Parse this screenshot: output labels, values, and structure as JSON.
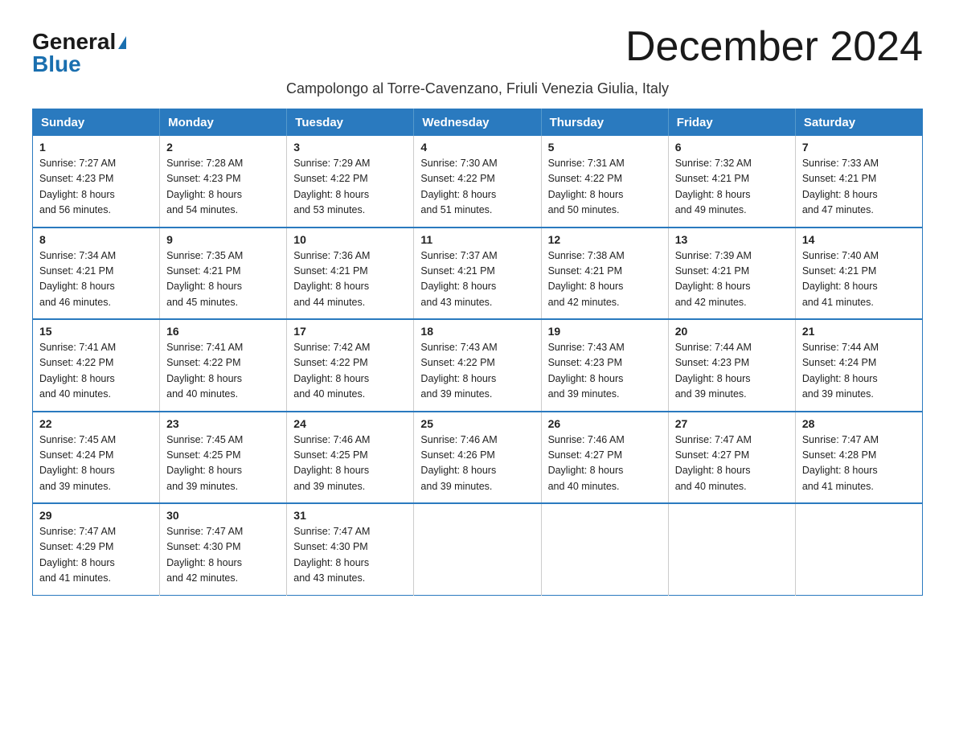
{
  "logo": {
    "general": "General",
    "blue": "Blue",
    "triangle": "▶"
  },
  "title": "December 2024",
  "subtitle": "Campolongo al Torre-Cavenzano, Friuli Venezia Giulia, Italy",
  "days_of_week": [
    "Sunday",
    "Monday",
    "Tuesday",
    "Wednesday",
    "Thursday",
    "Friday",
    "Saturday"
  ],
  "weeks": [
    [
      {
        "day": "1",
        "sunrise": "7:27 AM",
        "sunset": "4:23 PM",
        "daylight": "8 hours and 56 minutes."
      },
      {
        "day": "2",
        "sunrise": "7:28 AM",
        "sunset": "4:23 PM",
        "daylight": "8 hours and 54 minutes."
      },
      {
        "day": "3",
        "sunrise": "7:29 AM",
        "sunset": "4:22 PM",
        "daylight": "8 hours and 53 minutes."
      },
      {
        "day": "4",
        "sunrise": "7:30 AM",
        "sunset": "4:22 PM",
        "daylight": "8 hours and 51 minutes."
      },
      {
        "day": "5",
        "sunrise": "7:31 AM",
        "sunset": "4:22 PM",
        "daylight": "8 hours and 50 minutes."
      },
      {
        "day": "6",
        "sunrise": "7:32 AM",
        "sunset": "4:21 PM",
        "daylight": "8 hours and 49 minutes."
      },
      {
        "day": "7",
        "sunrise": "7:33 AM",
        "sunset": "4:21 PM",
        "daylight": "8 hours and 47 minutes."
      }
    ],
    [
      {
        "day": "8",
        "sunrise": "7:34 AM",
        "sunset": "4:21 PM",
        "daylight": "8 hours and 46 minutes."
      },
      {
        "day": "9",
        "sunrise": "7:35 AM",
        "sunset": "4:21 PM",
        "daylight": "8 hours and 45 minutes."
      },
      {
        "day": "10",
        "sunrise": "7:36 AM",
        "sunset": "4:21 PM",
        "daylight": "8 hours and 44 minutes."
      },
      {
        "day": "11",
        "sunrise": "7:37 AM",
        "sunset": "4:21 PM",
        "daylight": "8 hours and 43 minutes."
      },
      {
        "day": "12",
        "sunrise": "7:38 AM",
        "sunset": "4:21 PM",
        "daylight": "8 hours and 42 minutes."
      },
      {
        "day": "13",
        "sunrise": "7:39 AM",
        "sunset": "4:21 PM",
        "daylight": "8 hours and 42 minutes."
      },
      {
        "day": "14",
        "sunrise": "7:40 AM",
        "sunset": "4:21 PM",
        "daylight": "8 hours and 41 minutes."
      }
    ],
    [
      {
        "day": "15",
        "sunrise": "7:41 AM",
        "sunset": "4:22 PM",
        "daylight": "8 hours and 40 minutes."
      },
      {
        "day": "16",
        "sunrise": "7:41 AM",
        "sunset": "4:22 PM",
        "daylight": "8 hours and 40 minutes."
      },
      {
        "day": "17",
        "sunrise": "7:42 AM",
        "sunset": "4:22 PM",
        "daylight": "8 hours and 40 minutes."
      },
      {
        "day": "18",
        "sunrise": "7:43 AM",
        "sunset": "4:22 PM",
        "daylight": "8 hours and 39 minutes."
      },
      {
        "day": "19",
        "sunrise": "7:43 AM",
        "sunset": "4:23 PM",
        "daylight": "8 hours and 39 minutes."
      },
      {
        "day": "20",
        "sunrise": "7:44 AM",
        "sunset": "4:23 PM",
        "daylight": "8 hours and 39 minutes."
      },
      {
        "day": "21",
        "sunrise": "7:44 AM",
        "sunset": "4:24 PM",
        "daylight": "8 hours and 39 minutes."
      }
    ],
    [
      {
        "day": "22",
        "sunrise": "7:45 AM",
        "sunset": "4:24 PM",
        "daylight": "8 hours and 39 minutes."
      },
      {
        "day": "23",
        "sunrise": "7:45 AM",
        "sunset": "4:25 PM",
        "daylight": "8 hours and 39 minutes."
      },
      {
        "day": "24",
        "sunrise": "7:46 AM",
        "sunset": "4:25 PM",
        "daylight": "8 hours and 39 minutes."
      },
      {
        "day": "25",
        "sunrise": "7:46 AM",
        "sunset": "4:26 PM",
        "daylight": "8 hours and 39 minutes."
      },
      {
        "day": "26",
        "sunrise": "7:46 AM",
        "sunset": "4:27 PM",
        "daylight": "8 hours and 40 minutes."
      },
      {
        "day": "27",
        "sunrise": "7:47 AM",
        "sunset": "4:27 PM",
        "daylight": "8 hours and 40 minutes."
      },
      {
        "day": "28",
        "sunrise": "7:47 AM",
        "sunset": "4:28 PM",
        "daylight": "8 hours and 41 minutes."
      }
    ],
    [
      {
        "day": "29",
        "sunrise": "7:47 AM",
        "sunset": "4:29 PM",
        "daylight": "8 hours and 41 minutes."
      },
      {
        "day": "30",
        "sunrise": "7:47 AM",
        "sunset": "4:30 PM",
        "daylight": "8 hours and 42 minutes."
      },
      {
        "day": "31",
        "sunrise": "7:47 AM",
        "sunset": "4:30 PM",
        "daylight": "8 hours and 43 minutes."
      },
      null,
      null,
      null,
      null
    ]
  ],
  "labels": {
    "sunrise": "Sunrise:",
    "sunset": "Sunset:",
    "daylight": "Daylight:"
  }
}
